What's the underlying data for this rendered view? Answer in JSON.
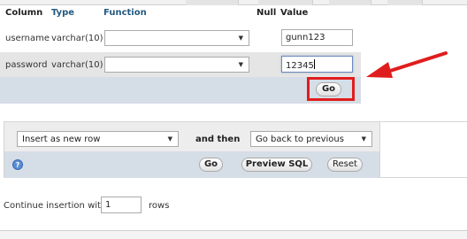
{
  "table_header": {
    "column": "Column",
    "type": "Type",
    "function": "Function",
    "null": "Null",
    "value": "Value"
  },
  "rows": [
    {
      "column": "username",
      "type": "varchar(10)",
      "function": "",
      "value": "gunn123"
    },
    {
      "column": "password",
      "type": "varchar(10)",
      "function": "",
      "value": "12345"
    }
  ],
  "form_go_label": "Go",
  "action": {
    "insert_option": "Insert as new row",
    "and_then": "and then",
    "after_option": "Go back to previous page",
    "go_label": "Go",
    "preview_sql_label": "Preview SQL",
    "reset_label": "Reset"
  },
  "continue": {
    "label": "Continue insertion with",
    "value": "1",
    "suffix": "rows"
  },
  "colors": {
    "header_blue": "#235a81",
    "highlight_red": "#e01d1d",
    "go_bar": "#d5dde6"
  },
  "icons": {
    "help": "help-icon",
    "dropdown": "chevron-down-icon",
    "annotation": "red-arrow-icon"
  }
}
